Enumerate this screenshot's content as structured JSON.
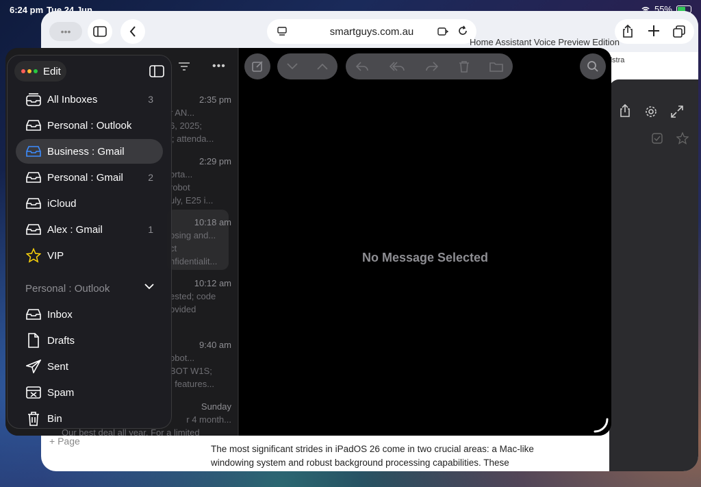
{
  "status_bar": {
    "time": "6:24 pm",
    "date": "Tue 24 Jun",
    "battery": "55%"
  },
  "safari": {
    "url": "smartguys.com.au",
    "bg_article_title": "Home Assistant Voice Preview Edition",
    "bg_telstra": "Telstra",
    "page_tag": "+ Page",
    "article_text": "The most significant strides in iPadOS 26 come in two crucial areas: a Mac-like windowing system and robust background processing capabilities. These"
  },
  "mail": {
    "no_message": "No Message Selected",
    "sidebar": {
      "edit_label": "Edit",
      "items": [
        {
          "label": "All Inboxes",
          "count": "3",
          "icon": "all-inboxes-icon"
        },
        {
          "label": "Personal : Outlook",
          "count": "",
          "icon": "inbox-icon"
        },
        {
          "label": "Business : Gmail",
          "count": "",
          "icon": "inbox-icon",
          "selected": true
        },
        {
          "label": "Personal : Gmail",
          "count": "2",
          "icon": "inbox-icon"
        },
        {
          "label": "iCloud",
          "count": "",
          "icon": "inbox-icon"
        },
        {
          "label": "Alex : Gmail",
          "count": "1",
          "icon": "inbox-icon"
        },
        {
          "label": "VIP",
          "count": "",
          "icon": "star-icon"
        }
      ],
      "section_title": "Personal : Outlook",
      "section_items": [
        {
          "label": "Inbox",
          "icon": "inbox-icon"
        },
        {
          "label": "Drafts",
          "icon": "document-icon"
        },
        {
          "label": "Sent",
          "icon": "paperplane-icon"
        },
        {
          "label": "Spam",
          "icon": "junk-icon"
        },
        {
          "label": "Bin",
          "icon": "trash-icon"
        }
      ]
    },
    "messages": [
      {
        "time": "2:35 pm",
        "line1": "r AN...",
        "line2": "6, 2025;",
        "line3": "l; attenda..."
      },
      {
        "time": "2:29 pm",
        "line1": "orta...",
        "line2": "robot",
        "line3": "uly, E25 i..."
      },
      {
        "time": "10:18 am",
        "line1": "osing and...",
        "line2": "ct",
        "line3": "nfidentialit..."
      },
      {
        "time": "10:12 am",
        "line1": "",
        "line2": "ested; code",
        "line3": "ovided"
      },
      {
        "time": "9:40 am",
        "line1": "obot...",
        "line2": "BOT W1S;",
        "line3": "; features..."
      },
      {
        "time": "Sunday",
        "line1": "r 4 month...",
        "line2": "Our best deal all year. For a limited",
        "line3": ""
      }
    ]
  }
}
